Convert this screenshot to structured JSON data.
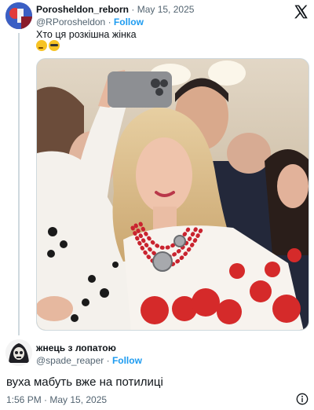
{
  "quoted_tweet": {
    "display_name": "Porosheldon_reborn",
    "separator": "·",
    "date": "May 15, 2025",
    "handle": "@RPorosheldon",
    "handle_separator": "·",
    "follow_label": "Follow",
    "text": "Хто ця розкішна жінка",
    "emojis": [
      "thinking-face",
      "face-with-monocle"
    ]
  },
  "reply_tweet": {
    "display_name": "жнець з лопатою",
    "handle": "@spade_reaper",
    "handle_separator": "·",
    "follow_label": "Follow",
    "text": "вуха мабуть вже на потилиці",
    "timestamp": "1:56 PM · May 15, 2025"
  },
  "icons": {
    "platform_logo": "x-logo-icon",
    "info": "info-icon"
  },
  "colors": {
    "accent": "#1d9bf0",
    "secondary_text": "#536471",
    "primary_text": "#0f1419",
    "thread_line": "#cfd9de"
  }
}
